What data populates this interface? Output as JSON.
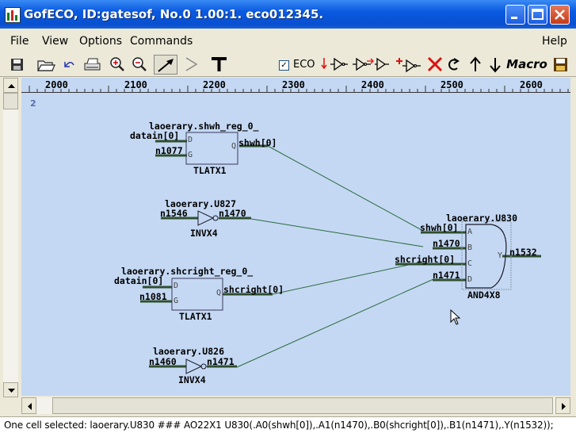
{
  "window": {
    "title": "GofECO, ID:gatesof, No.0 1.00:1. eco012345."
  },
  "menu": {
    "file": "File",
    "view": "View",
    "options": "Options",
    "commands": "Commands",
    "help": "Help"
  },
  "toolbar": {
    "eco_label": "ECO",
    "eco_checked": true,
    "macro_label": "Macro"
  },
  "ruler": {
    "ticks": [
      "2000",
      "2100",
      "2200",
      "2300",
      "2400",
      "2500",
      "2600"
    ]
  },
  "page_number": "2",
  "schematic": {
    "cells": [
      {
        "instance": "laoerary.shwh_reg_0_",
        "type": "TLATX1",
        "pins": [
          "D",
          "G",
          "Q"
        ],
        "nets": [
          "datain[0]",
          "n1077",
          "shwh[0]"
        ]
      },
      {
        "instance": "laoerary.U827",
        "type": "INVX4",
        "nets": [
          "n1546",
          "n1470"
        ]
      },
      {
        "instance": "laoerary.shcright_reg_0_",
        "type": "TLATX1",
        "pins": [
          "D",
          "G",
          "Q"
        ],
        "nets": [
          "datain[0]",
          "n1081",
          "shcright[0]"
        ]
      },
      {
        "instance": "laoerary.U826",
        "type": "INVX4",
        "nets": [
          "n1460",
          "n1471"
        ]
      },
      {
        "instance": "laoerary.U830",
        "type": "AND4X8",
        "pins": [
          "A",
          "B",
          "C",
          "D",
          "Y"
        ],
        "nets": [
          "shwh[0]",
          "n1470",
          "shcright[0]",
          "n1471",
          "n1532"
        ]
      }
    ]
  },
  "status": {
    "text": "One cell selected: laoerary.U830 ### AO22X1 U830(.A0(shwh[0]),.A1(n1470),.B0(shcright[0]),.B1(n1471),.Y(n1532));"
  },
  "colors": {
    "canvas": "#c4d8f3",
    "wire": "#2b6b3f",
    "net": "#2f4f2f",
    "title_bar": "#0a5ae0"
  }
}
